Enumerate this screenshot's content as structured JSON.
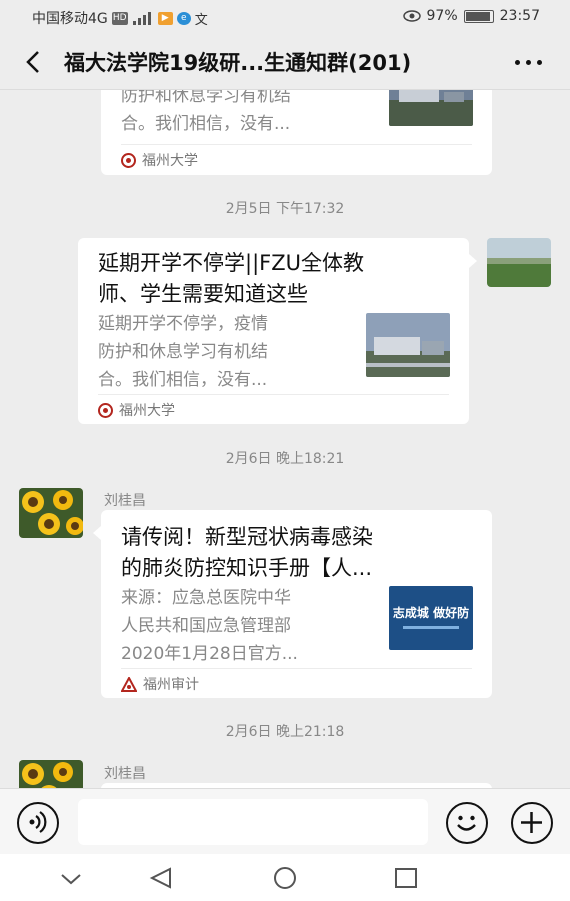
{
  "status_bar": {
    "carrier": "中国移动4G",
    "battery": "97%",
    "time": "23:57"
  },
  "header": {
    "title": "福大法学院19级研...生通知群(201)"
  },
  "messages": {
    "m1": {
      "desc_line1": "防护和休息学习有机结",
      "desc_line2": "合。我们相信，没有...",
      "source": "福州大学"
    },
    "ts1": "2月5日 下午17:32",
    "m2": {
      "title_line1": "延期开学不停学||FZU全体教",
      "title_line2": "师、学生需要知道这些",
      "desc_line1": "延期开学不停学，疫情",
      "desc_line2": "防护和休息学习有机结",
      "desc_line3": "合。我们相信，没有...",
      "source": "福州大学"
    },
    "ts2": "2月6日 晚上18:21",
    "m3": {
      "sender": "刘桂昌",
      "title_line1": "请传阅！新型冠状病毒感染",
      "title_line2": "的肺炎防控知识手册【人...",
      "desc_line1": "来源：应急总医院中华",
      "desc_line2": "人民共和国应急管理部",
      "desc_line3": "2020年1月28日官方...",
      "thumb_text": "志成城 做好防",
      "source": "福州审计"
    },
    "ts3": "2月6日 晚上21:18",
    "m4": {
      "sender": "刘桂昌"
    }
  },
  "input": {
    "placeholder": ""
  },
  "icons": {
    "voice": "voice-icon",
    "emoji": "emoji-icon",
    "plus": "plus-icon"
  },
  "colors": {
    "background": "#ededed",
    "bubble": "#ffffff",
    "muted_text": "#888888"
  }
}
